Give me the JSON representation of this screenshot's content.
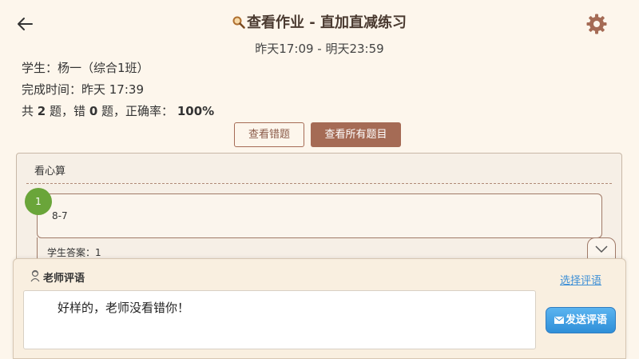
{
  "header": {
    "title": "查看作业 - 直加直减练习",
    "time_range": "昨天17:09 - 明天23:59",
    "icons": {
      "back": "arrow-left-icon",
      "title": "search-icon",
      "settings": "gear-icon"
    }
  },
  "student_info": {
    "student": "学生：杨一（综合1班）",
    "completion_time": "完成时间：昨天 17:39",
    "summary": {
      "prefix": "共",
      "total": "2",
      "mid1": "题，错",
      "wrong": "0",
      "mid2": "题，正确率：",
      "accuracy": "100%"
    }
  },
  "filter_buttons": {
    "wrong_only": "查看错题",
    "all_questions": "查看所有题目"
  },
  "question_card": {
    "section_title": "看心算",
    "number": "1",
    "question": "8-7",
    "answer": "学生答案：1"
  },
  "comment": {
    "title": "老师评语",
    "choose_link": "选择评语",
    "text": "好样的，老师没看错你！",
    "send_label": "发送评语"
  },
  "colors": {
    "background": "#fdf6ec",
    "primary_brown": "#a56b55",
    "badge_green": "#6aa53a",
    "link_blue": "#3d8fd6",
    "send_blue": "#2f8fd8",
    "gear": "#a56b55"
  }
}
